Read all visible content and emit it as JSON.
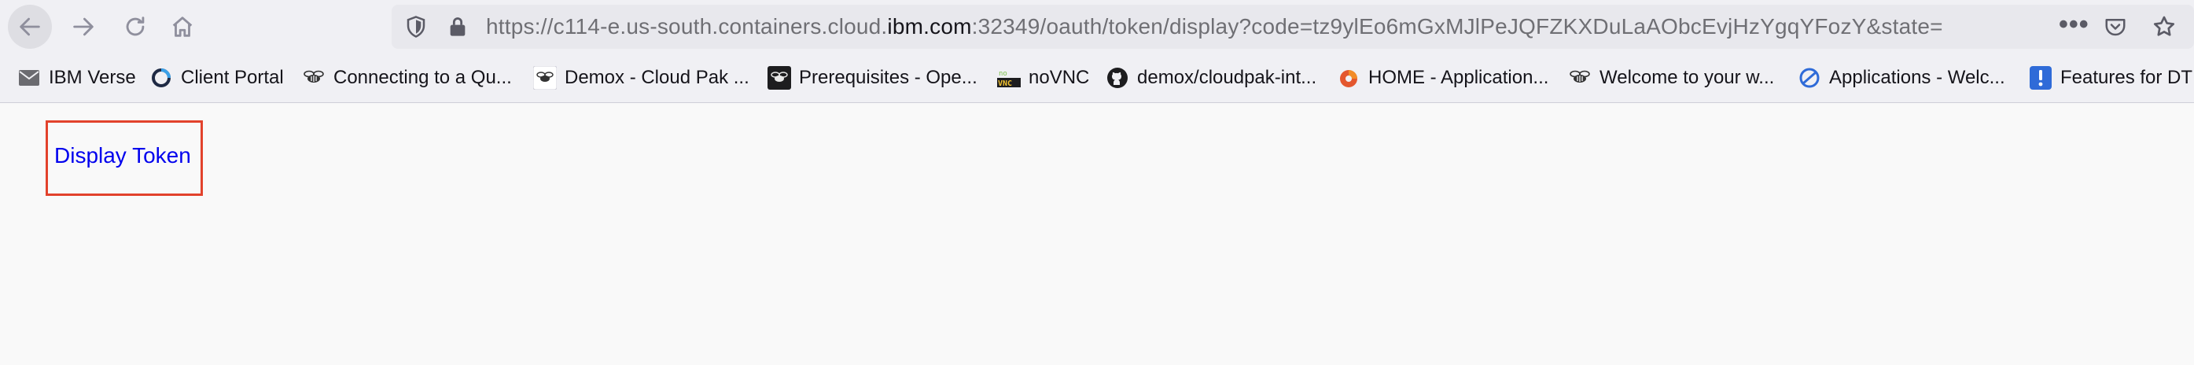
{
  "toolbar": {
    "url_prefix": "https://c114-e.us-south.containers.cloud.",
    "url_domain": "ibm.com",
    "url_suffix": ":32349/oauth/token/display?code=tz9ylEo6mGxMJlPeJQFZKXDuLaAObcEvjHzYgqYFozY&state=",
    "more_label": "•••"
  },
  "bookmarks": [
    {
      "label": "IBM Verse",
      "icon": "envelope-icon"
    },
    {
      "label": "Client Portal",
      "icon": "ring-icon"
    },
    {
      "label": "Connecting to a Qu...",
      "icon": "bee-icon"
    },
    {
      "label": "Demox - Cloud Pak ...",
      "icon": "bee-badge-icon"
    },
    {
      "label": "Prerequisites - Ope...",
      "icon": "bee-dark-badge-icon"
    },
    {
      "label": "noVNC",
      "icon": "novnc-icon"
    },
    {
      "label": "demox/cloudpak-int...",
      "icon": "github-icon"
    },
    {
      "label": "HOME - Application...",
      "icon": "orange-app-icon"
    },
    {
      "label": "Welcome to your w...",
      "icon": "bee-icon"
    },
    {
      "label": "Applications - Welc...",
      "icon": "blue-arc-icon"
    },
    {
      "label": "Features for DT",
      "icon": "exclamation-icon"
    }
  ],
  "content": {
    "link_label": "Display Token"
  },
  "colors": {
    "link": "#0000ee",
    "highlight_box": "#e2422c"
  }
}
